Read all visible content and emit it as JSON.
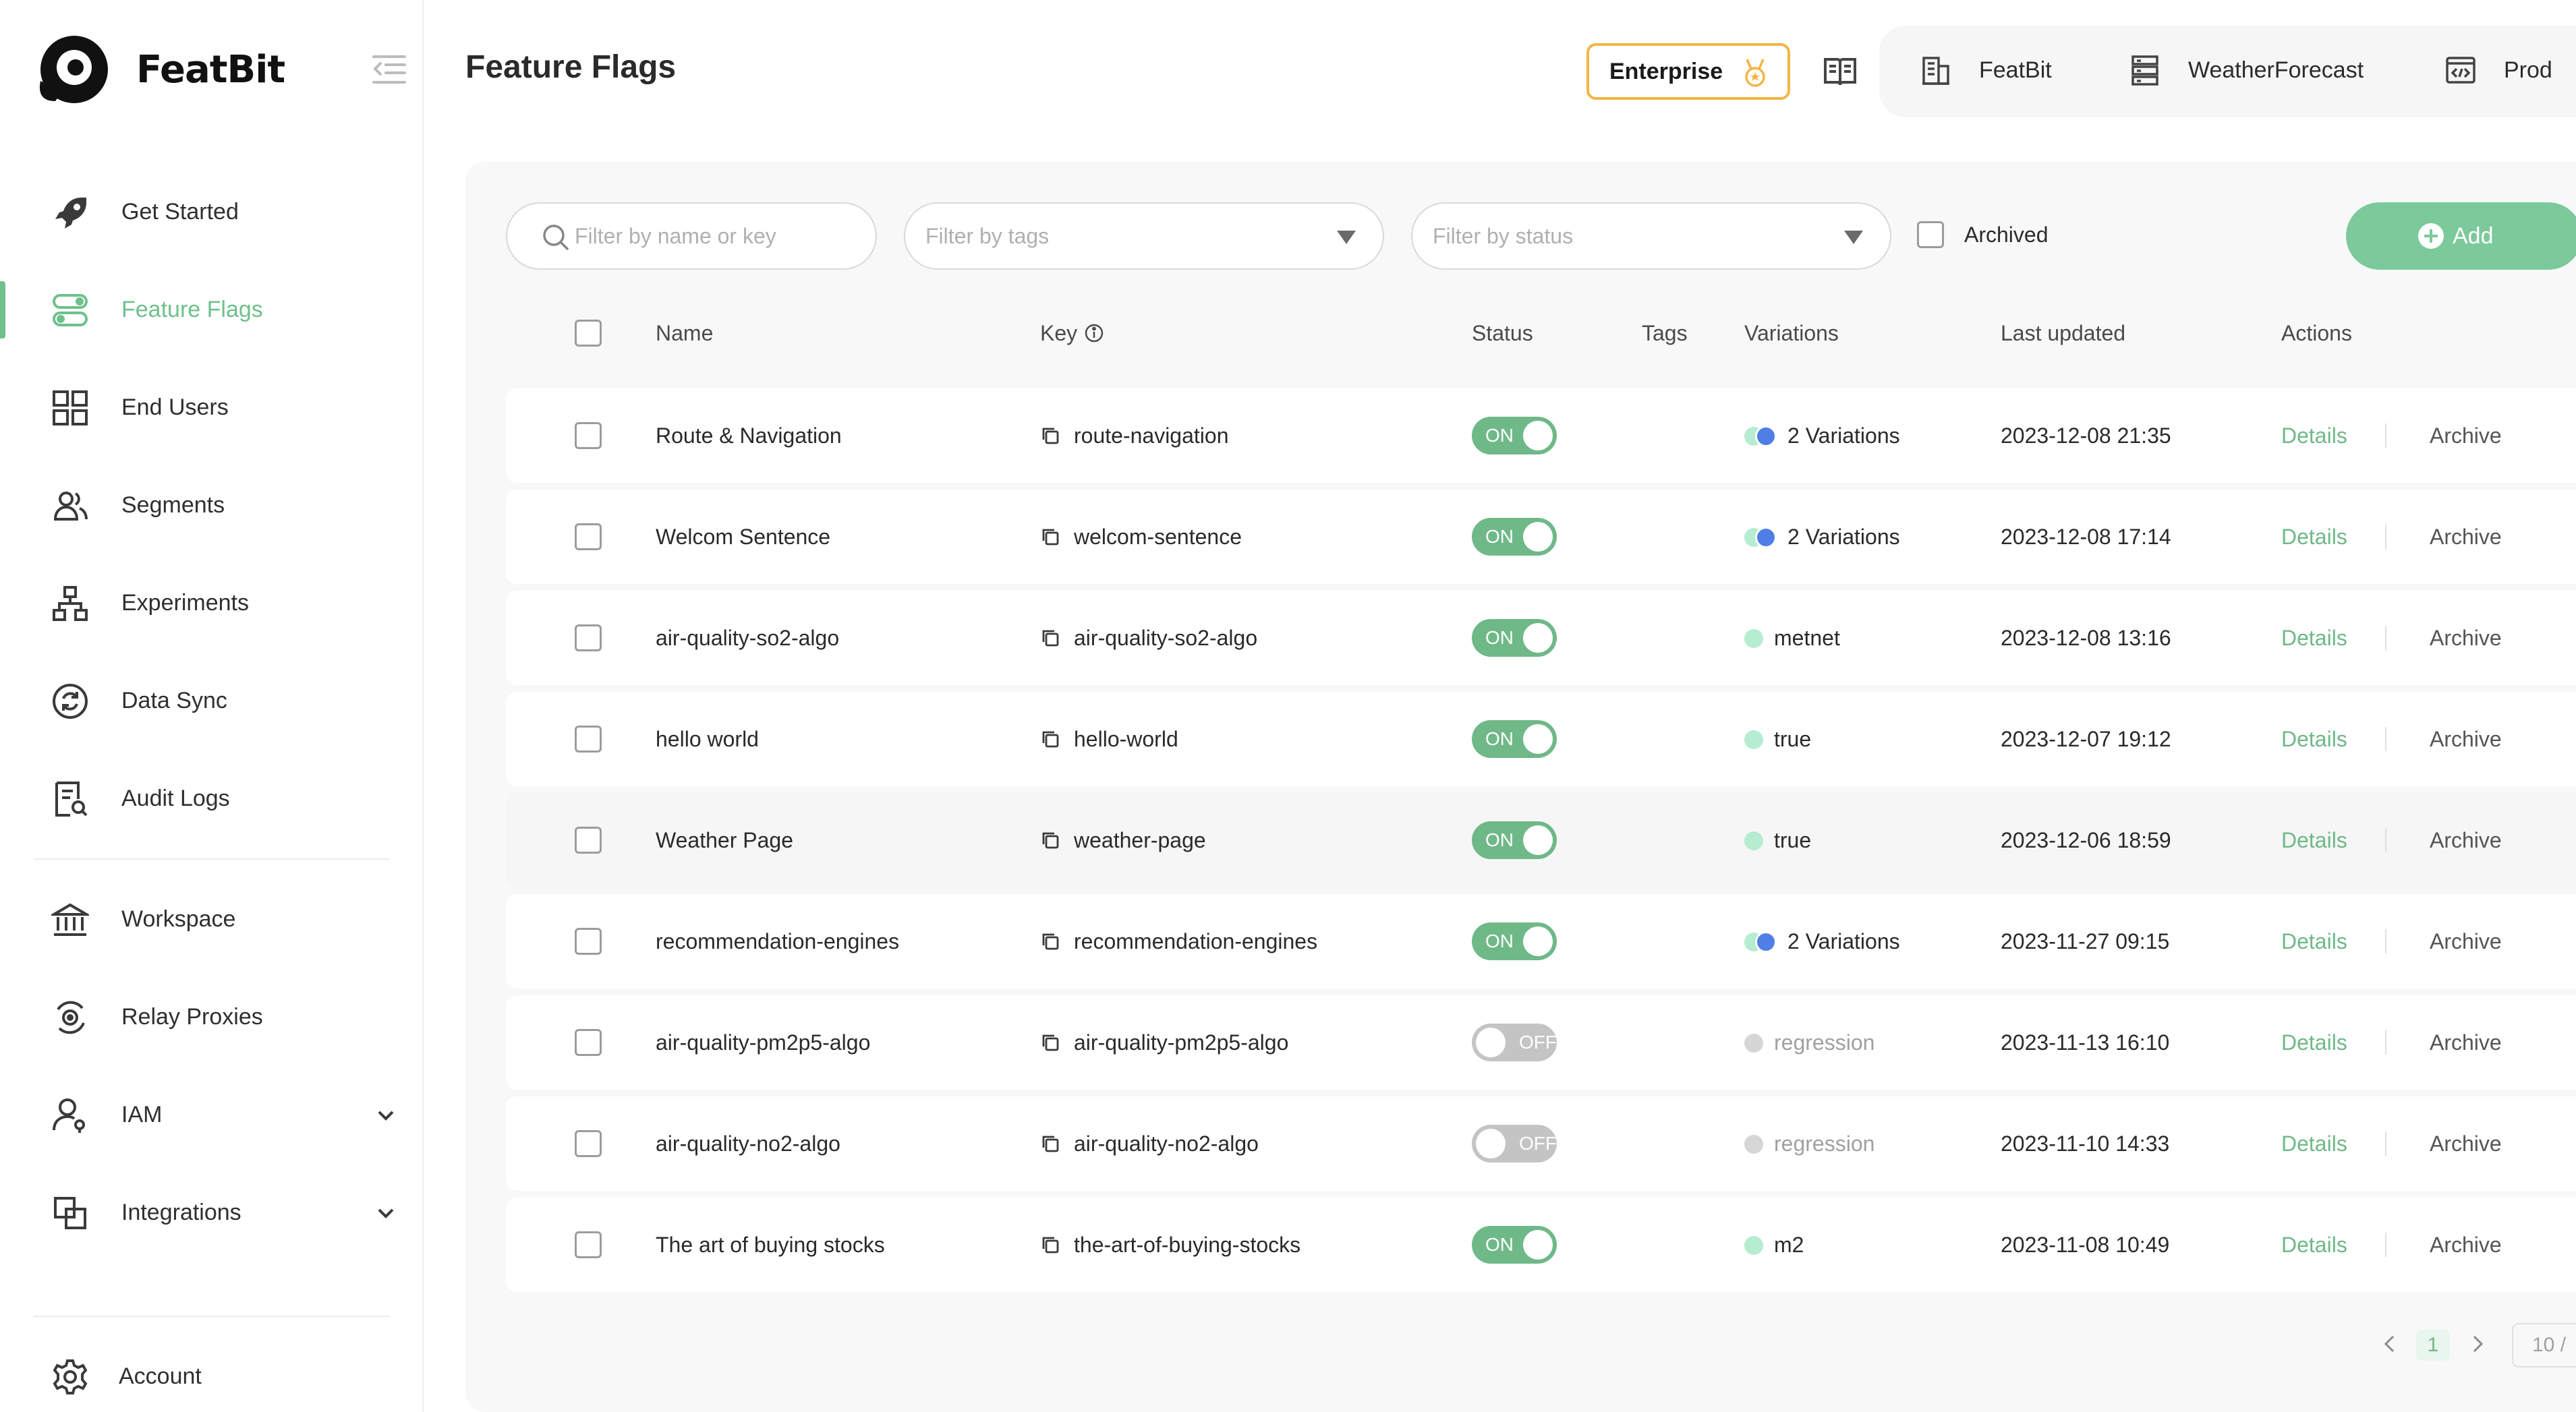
{
  "brand": {
    "name": "FeatBit"
  },
  "sidebar": {
    "items": [
      {
        "label": "Get Started",
        "icon": "rocket-icon"
      },
      {
        "label": "Feature Flags",
        "icon": "toggle-icon",
        "active": true
      },
      {
        "label": "End Users",
        "icon": "grid-icon"
      },
      {
        "label": "Segments",
        "icon": "users-icon"
      },
      {
        "label": "Experiments",
        "icon": "hierarchy-icon"
      },
      {
        "label": "Data Sync",
        "icon": "sync-icon"
      },
      {
        "label": "Audit Logs",
        "icon": "audit-icon"
      }
    ],
    "workspace_items": [
      {
        "label": "Workspace",
        "icon": "bank-icon"
      },
      {
        "label": "Relay Proxies",
        "icon": "relay-icon"
      },
      {
        "label": "IAM",
        "icon": "user-key-icon",
        "expandable": true
      },
      {
        "label": "Integrations",
        "icon": "integration-icon",
        "expandable": true
      }
    ],
    "account": {
      "label": "Account",
      "icon": "gear-icon"
    }
  },
  "header": {
    "title": "Feature Flags",
    "enterprise_label": "Enterprise",
    "organization": "FeatBit",
    "project": "WeatherForecast",
    "environment": "Prod"
  },
  "filters": {
    "search_placeholder": "Filter by name or key",
    "tags_placeholder": "Filter by tags",
    "status_placeholder": "Filter by status",
    "archived_label": "Archived",
    "add_label": "Add"
  },
  "table": {
    "columns": {
      "name": "Name",
      "key": "Key",
      "status": "Status",
      "tags": "Tags",
      "variations": "Variations",
      "last_updated": "Last updated",
      "actions": "Actions"
    },
    "action_details": "Details",
    "action_archive": "Archive",
    "rows": [
      {
        "name": "Route & Navigation",
        "key": "route-navigation",
        "status": "ON",
        "variations": "2 Variations",
        "var_style": "multi",
        "updated": "2023-12-08 21:35"
      },
      {
        "name": "Welcom Sentence",
        "key": "welcom-sentence",
        "status": "ON",
        "variations": "2 Variations",
        "var_style": "multi",
        "updated": "2023-12-08 17:14"
      },
      {
        "name": "air-quality-so2-algo",
        "key": "air-quality-so2-algo",
        "status": "ON",
        "variations": "metnet",
        "var_style": "single",
        "updated": "2023-12-08 13:16"
      },
      {
        "name": "hello world",
        "key": "hello-world",
        "status": "ON",
        "variations": "true",
        "var_style": "single",
        "updated": "2023-12-07 19:12"
      },
      {
        "name": "Weather Page",
        "key": "weather-page",
        "status": "ON",
        "variations": "true",
        "var_style": "single",
        "updated": "2023-12-06 18:59"
      },
      {
        "name": "recommendation-engines",
        "key": "recommendation-engines",
        "status": "ON",
        "variations": "2 Variations",
        "var_style": "multi",
        "updated": "2023-11-27 09:15"
      },
      {
        "name": "air-quality-pm2p5-algo",
        "key": "air-quality-pm2p5-algo",
        "status": "OFF",
        "variations": "regression",
        "var_style": "off",
        "updated": "2023-11-13 16:10"
      },
      {
        "name": "air-quality-no2-algo",
        "key": "air-quality-no2-algo",
        "status": "OFF",
        "variations": "regression",
        "var_style": "off",
        "updated": "2023-11-10 14:33"
      },
      {
        "name": "The art of buying stocks",
        "key": "the-art-of-buying-stocks",
        "status": "ON",
        "variations": "m2",
        "var_style": "single",
        "updated": "2023-11-08 10:49"
      }
    ]
  },
  "pagination": {
    "current": "1",
    "page_size": "10 /"
  },
  "colors": {
    "accent": "#6fb888",
    "accent_light": "#7cc99b",
    "enterprise_border": "#f2b544",
    "variation_blue": "#4f7fe6",
    "variation_green": "#b6ecd0"
  }
}
